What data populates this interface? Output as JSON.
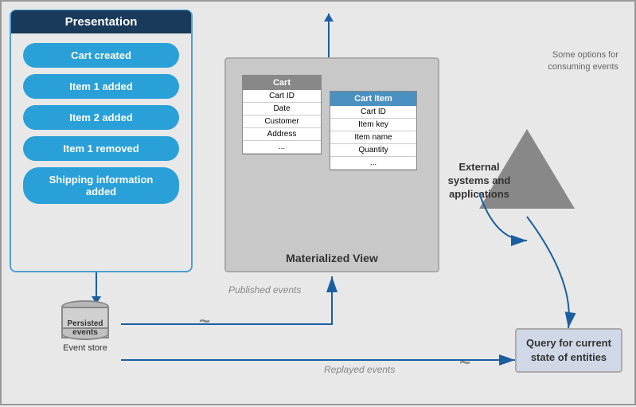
{
  "presentation": {
    "title": "Presentation",
    "events": [
      "Cart created",
      "Item 1 added",
      "Item 2 added",
      "Item 1 removed",
      "Shipping information added"
    ]
  },
  "event_store": {
    "cylinder_text": "Persisted events",
    "label": "Event store"
  },
  "tilde1": "~",
  "tilde2": "~",
  "published_events_label": "Published events",
  "replayed_events_label": "Replayed events",
  "materialized_view": {
    "label": "Materialized View",
    "cart_table": {
      "header": "Cart",
      "rows": [
        "Cart ID",
        "Date",
        "Customer",
        "Address",
        "..."
      ]
    },
    "cart_item_table": {
      "header": "Cart Item",
      "rows": [
        "Cart ID",
        "Item key",
        "Item name",
        "Quantity",
        "..."
      ]
    }
  },
  "external_systems": {
    "label": "External\nsystems and\napplications"
  },
  "some_options": "Some options for\nconsuming events",
  "query_box": {
    "text": "Query for\ncurrent state\nof entities"
  }
}
